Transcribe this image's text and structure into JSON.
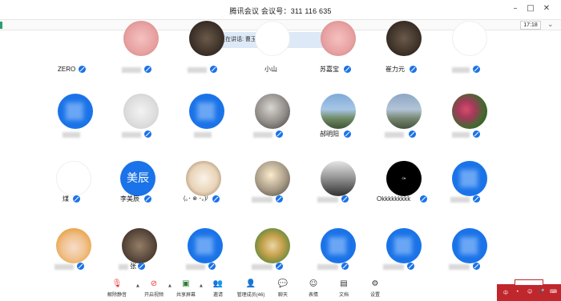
{
  "window": {
    "title": "腾讯会议  会议号：311 116 635",
    "controls": [
      "minimize",
      "maximize",
      "close"
    ]
  },
  "status": {
    "clock": "17:18",
    "speaking_label": "正在讲话: 曹玉刚;"
  },
  "participants": {
    "row0": [
      {
        "name": "ZERO",
        "mic": "muted"
      },
      {
        "name": "",
        "mic": "muted"
      },
      {
        "name": "",
        "mic": "muted"
      },
      {
        "name": "小山",
        "mic": "none"
      },
      {
        "name": "苏嘉宝",
        "mic": "muted"
      },
      {
        "name": "崔力元",
        "mic": "muted"
      },
      {
        "name": "",
        "mic": "muted"
      }
    ],
    "row1": [
      {
        "name": "",
        "mic": "none"
      },
      {
        "name": "",
        "mic": "muted"
      },
      {
        "name": "",
        "mic": "none"
      },
      {
        "name": "",
        "mic": "muted"
      },
      {
        "name": "郝明阳",
        "mic": "muted"
      },
      {
        "name": "",
        "mic": "muted"
      },
      {
        "name": "",
        "mic": "muted"
      }
    ],
    "row2": [
      {
        "name": "煤",
        "mic": "muted"
      },
      {
        "name": "李美辰",
        "mic": "muted",
        "avatar_text": "美辰"
      },
      {
        "name": "(｡･ ⊗ ･｡)/",
        "mic": "muted"
      },
      {
        "name": "",
        "mic": "muted"
      },
      {
        "name": "",
        "mic": "muted"
      },
      {
        "name": "Okkkkkkkkk",
        "mic": "muted",
        "avatar_text": "Ok"
      },
      {
        "name": "",
        "mic": "muted"
      }
    ],
    "row3": [
      {
        "name": "",
        "mic": "muted"
      },
      {
        "name": "张",
        "mic": "muted"
      },
      {
        "name": "",
        "mic": "muted"
      },
      {
        "name": "",
        "mic": "muted"
      },
      {
        "name": "",
        "mic": "muted"
      },
      {
        "name": "",
        "mic": "muted"
      },
      {
        "name": "",
        "mic": "muted"
      }
    ]
  },
  "toolbar": {
    "unmute": "解除静音",
    "start_video": "开启视频",
    "share_screen": "共享屏幕",
    "invite": "邀请",
    "manage_members": "管理成员(46)",
    "chat": "聊天",
    "reactions": "表情",
    "docs": "文档",
    "settings": "设置"
  },
  "ime": {
    "lang": "中",
    "punct": "•"
  },
  "colors": {
    "accent": "#1a73e8",
    "banner": "#dde9f7",
    "tray": "#c0272d"
  }
}
